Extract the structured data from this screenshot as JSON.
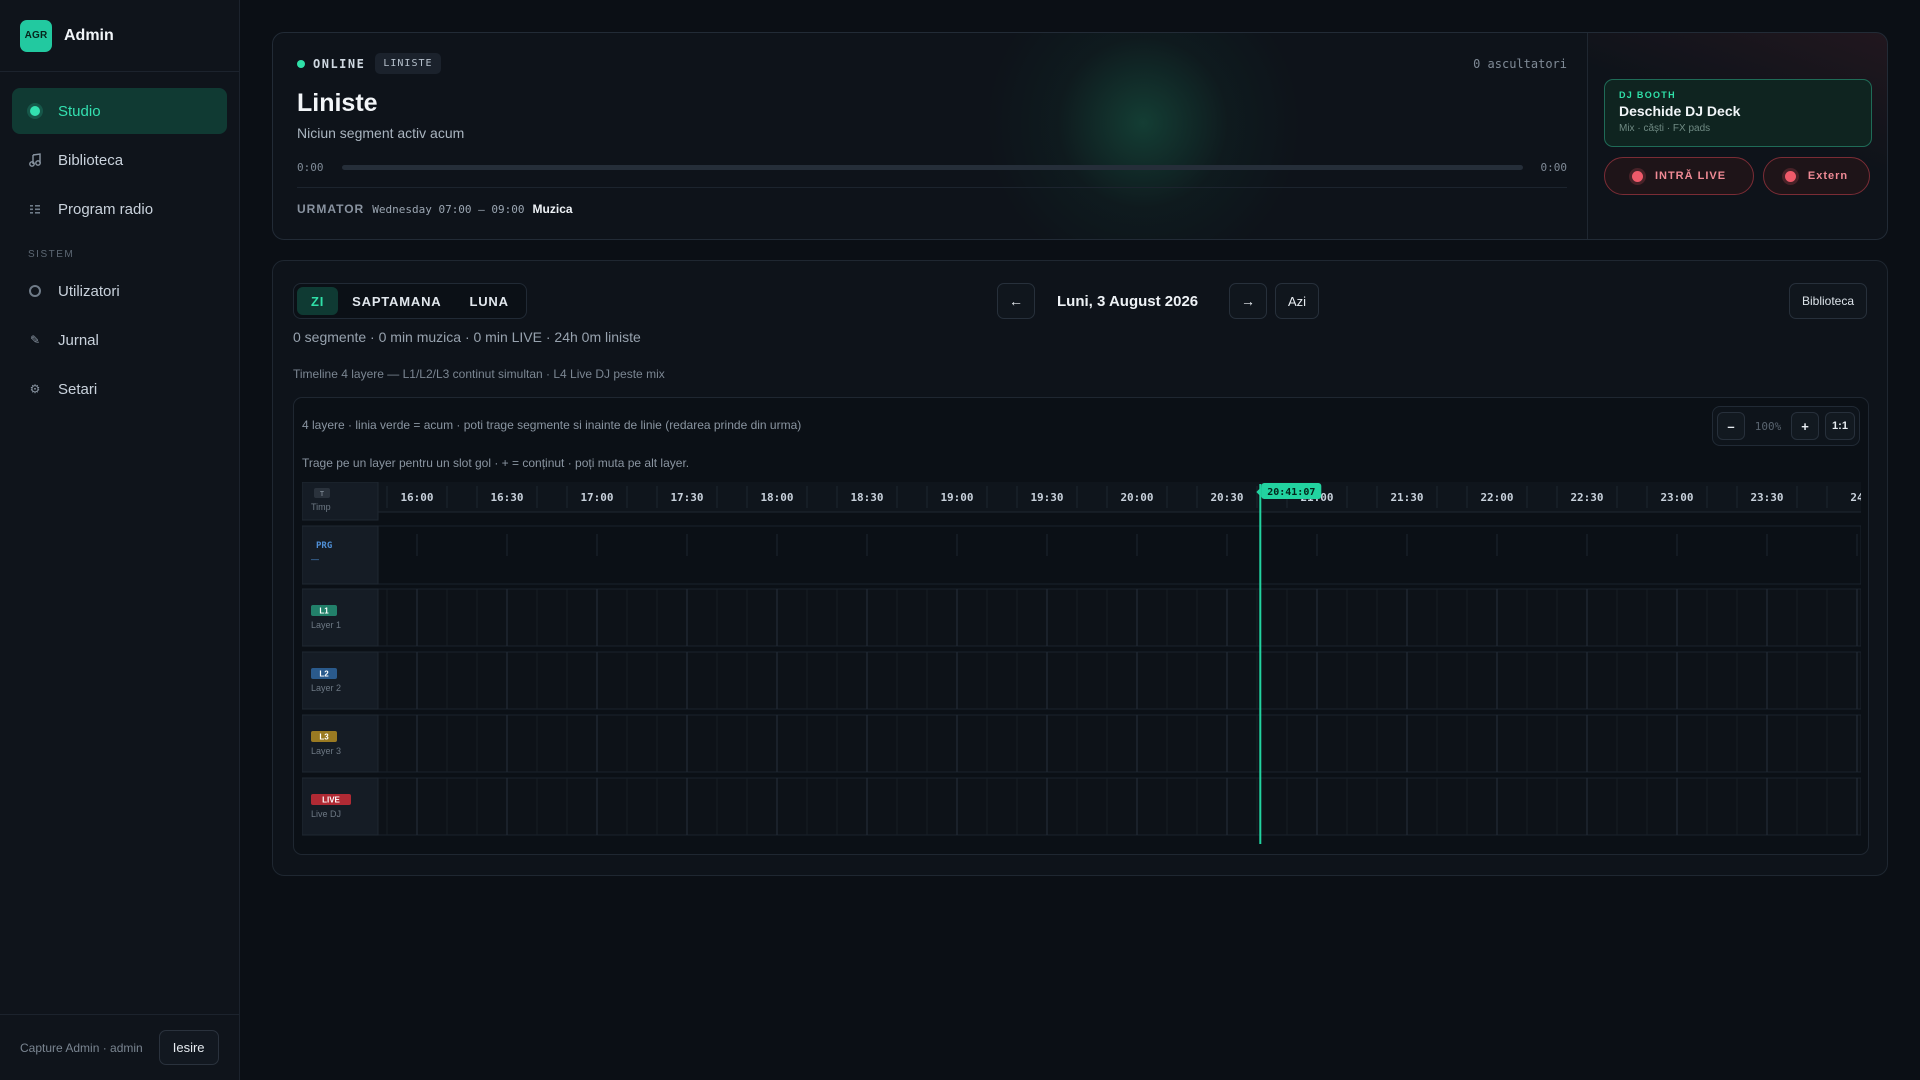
{
  "brand": {
    "logo": "AGR",
    "name": "Admin"
  },
  "nav": {
    "items": [
      {
        "label": "Studio",
        "icon": "dot-icon",
        "active": true
      },
      {
        "label": "Biblioteca",
        "icon": "music-note-icon"
      },
      {
        "label": "Program radio",
        "icon": "list-icon"
      }
    ],
    "section_label": "SISTEM",
    "system_items": [
      {
        "label": "Utilizatori",
        "icon": "users-ring-icon"
      },
      {
        "label": "Jurnal",
        "icon": "pencil-icon"
      },
      {
        "label": "Setari",
        "icon": "gear-icon"
      }
    ]
  },
  "footer": {
    "user": "Capture Admin · admin",
    "logout": "Iesire"
  },
  "now_playing": {
    "status": "ONLINE",
    "tag": "LINISTE",
    "listeners": "0 ascultatori",
    "title": "Liniste",
    "subtitle": "Niciun segment activ acum",
    "time_elapsed": "0:00",
    "time_total": "0:00",
    "progress": 0,
    "next_label": "URMATOR",
    "next_when": "Wednesday 07:00 – 09:00",
    "next_name": "Muzica"
  },
  "dj_booth": {
    "kicker": "DJ BOOTH",
    "title": "Deschide DJ Deck",
    "subtitle": "Mix · căști · FX pads",
    "live_button": "INTRĂ LIVE",
    "extern_button": "Extern"
  },
  "schedule": {
    "tabs": [
      {
        "label": "ZI",
        "active": true
      },
      {
        "label": "SAPTAMANA"
      },
      {
        "label": "LUNA"
      }
    ],
    "prev_icon": "←",
    "next_icon": "→",
    "date": "Luni, 3 August 2026",
    "today": "Azi",
    "library": "Biblioteca",
    "summary": "0 segmente · 0 min muzica · 0 min LIVE · 24h 0m liniste",
    "timeline_note": "Timeline 4 layere — L1/L2/L3 continut simultan · L4 Live DJ peste mix",
    "hint1": "4 layere · linia verde = acum · poti trage segmente si inainte de linie (redarea prinde din urma)",
    "hint2": "Trage pe un layer pentru un slot gol · + = conținut · poți muta pe alt layer.",
    "zoom": {
      "minus": "–",
      "value": "100%",
      "plus": "+",
      "reset": "1:1"
    }
  },
  "timeline": {
    "ticks": [
      "16:00",
      "16:30",
      "17:00",
      "17:30",
      "18:00",
      "18:30",
      "19:00",
      "19:30",
      "20:00",
      "20:30",
      "21:00",
      "21:30",
      "22:00",
      "22:30",
      "23:00",
      "23:30",
      "24"
    ],
    "now_label": "20:41:07",
    "now_minutes": 1241.1,
    "start_minutes": 939.25,
    "rows": [
      {
        "chip": "T",
        "sub": "Timp"
      },
      {
        "chip": "PRG",
        "sub": "—"
      },
      {
        "chip": "L1",
        "sub": "Layer 1",
        "color": "#22806a"
      },
      {
        "chip": "L2",
        "sub": "Layer 2",
        "color": "#2a5a8c"
      },
      {
        "chip": "L3",
        "sub": "Layer 3",
        "color": "#9a7a22"
      },
      {
        "chip": "LIVE",
        "sub": "Live DJ",
        "color": "#b02a34"
      }
    ]
  }
}
